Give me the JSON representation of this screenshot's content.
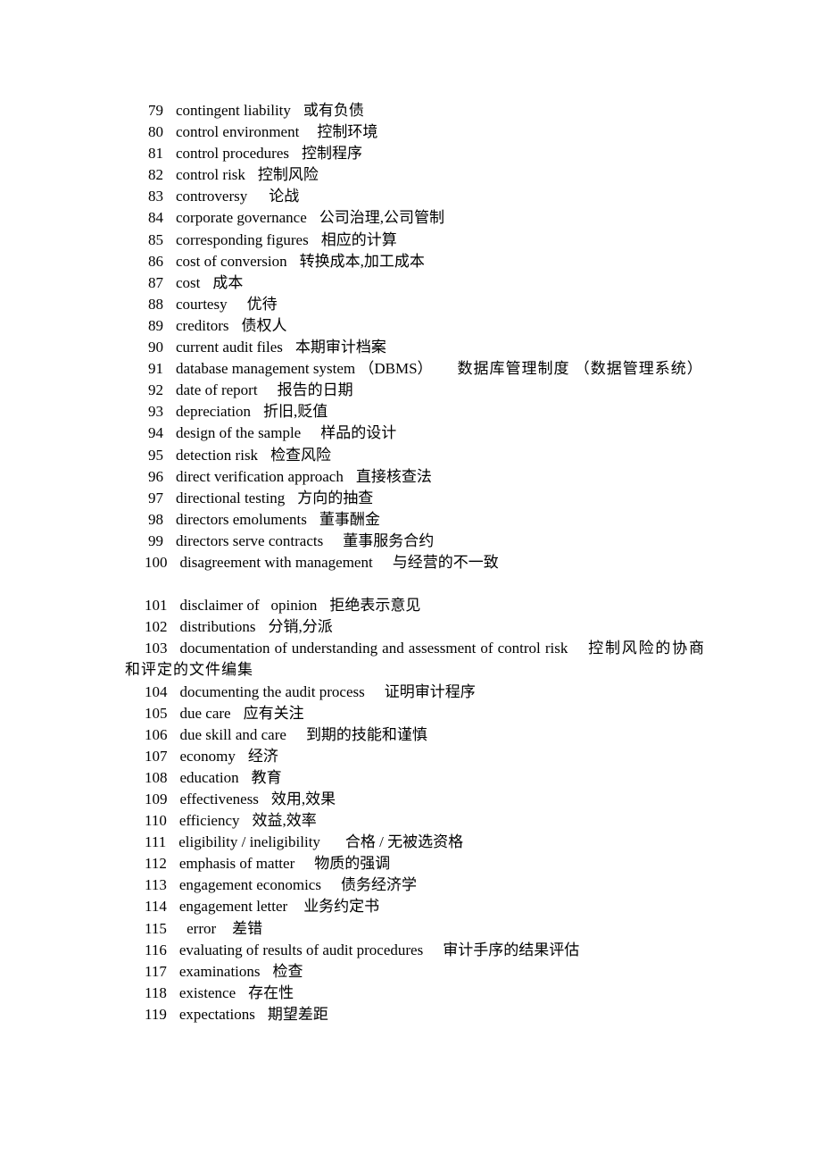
{
  "document": {
    "entries_group_1": [
      {
        "num": "79",
        "term": "contingent liability",
        "zh": "或有负债"
      },
      {
        "num": "80",
        "term": "control environment",
        "zh": "控制环境"
      },
      {
        "num": "81",
        "term": "control procedures",
        "zh": "控制程序"
      },
      {
        "num": "82",
        "term": "control risk",
        "zh": "控制风险"
      },
      {
        "num": "83",
        "term": "controversy",
        "zh": "论战"
      },
      {
        "num": "84",
        "term": "corporate governance",
        "zh": "公司治理,公司管制"
      },
      {
        "num": "85",
        "term": "corresponding figures",
        "zh": "相应的计算"
      },
      {
        "num": "86",
        "term": "cost of conversion",
        "zh": "转换成本,加工成本"
      },
      {
        "num": "87",
        "term": "cost",
        "zh": "成本"
      },
      {
        "num": "88",
        "term": "courtesy",
        "zh": "优待"
      },
      {
        "num": "89",
        "term": "creditors",
        "zh": "债权人"
      },
      {
        "num": "90",
        "term": "current audit files",
        "zh": "本期审计档案"
      },
      {
        "num": "91",
        "term": "database management system （DBMS）",
        "zh": "数据库管理制度 （数据管理系统）"
      },
      {
        "num": "92",
        "term": "date of report",
        "zh": "报告的日期"
      },
      {
        "num": "93",
        "term": "depreciation",
        "zh": "折旧,贬值"
      },
      {
        "num": "94",
        "term": "design of the sample",
        "zh": "样品的设计"
      },
      {
        "num": "95",
        "term": "detection risk",
        "zh": "检查风险"
      },
      {
        "num": "96",
        "term": "direct verification approach",
        "zh": "直接核查法"
      },
      {
        "num": "97",
        "term": "directional testing",
        "zh": "方向的抽查"
      },
      {
        "num": "98",
        "term": "directors emoluments",
        "zh": "董事酬金"
      },
      {
        "num": "99",
        "term": "directors serve contracts",
        "zh": "董事服务合约"
      },
      {
        "num": "100",
        "term": "disagreement with management",
        "zh": "与经营的不一致"
      }
    ],
    "entries_group_2": [
      {
        "num": "101",
        "term": "disclaimer of   opinion",
        "zh": "拒绝表示意见"
      },
      {
        "num": "102",
        "term": "distributions",
        "zh": "分销,分派"
      },
      {
        "num": "103",
        "term": "documentation of understanding and assessment of control risk",
        "zh": "控制风险的协商和评定的文件编集"
      },
      {
        "num": "104",
        "term": "documenting the audit process",
        "zh": "证明审计程序"
      },
      {
        "num": "105",
        "term": "due care",
        "zh": "应有关注"
      },
      {
        "num": "106",
        "term": "due skill and care",
        "zh": "到期的技能和谨慎"
      },
      {
        "num": "107",
        "term": "economy",
        "zh": "经济"
      },
      {
        "num": "108",
        "term": "education",
        "zh": "教育"
      },
      {
        "num": "109",
        "term": "effectiveness",
        "zh": "效用,效果"
      },
      {
        "num": "110",
        "term": "efficiency",
        "zh": "效益,效率"
      },
      {
        "num": "111",
        "term": "eligibility / ineligibility",
        "zh": "合格 / 无被选资格"
      },
      {
        "num": "112",
        "term": "emphasis of matter",
        "zh": "物质的强调"
      },
      {
        "num": "113",
        "term": "engagement economics",
        "zh": "债务经济学"
      },
      {
        "num": "114",
        "term": "engagement letter",
        "zh": "业务约定书"
      },
      {
        "num": "115",
        "term": " error",
        "zh": "差错"
      },
      {
        "num": "116",
        "term": "evaluating of results of audit procedures",
        "zh": "审计手序的结果评估"
      },
      {
        "num": "117",
        "term": "examinations",
        "zh": "检查"
      },
      {
        "num": "118",
        "term": "existence",
        "zh": "存在性"
      },
      {
        "num": "119",
        "term": "expectations",
        "zh": "期望差距"
      }
    ]
  }
}
